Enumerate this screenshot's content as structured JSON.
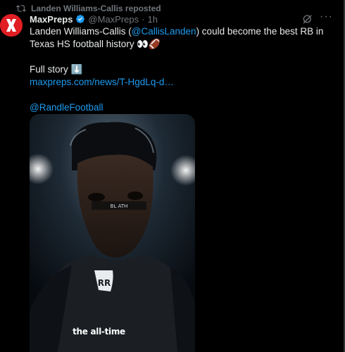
{
  "repost": {
    "text": "Landen Williams-Callis reposted",
    "icon": "repost-icon"
  },
  "post": {
    "author_name": "MaxPreps",
    "handle": "@MaxPreps",
    "separator": "·",
    "time": "1h",
    "avatar_icon": "maxpreps-logo-icon",
    "text_line1_a": "Landen Williams-Callis (",
    "text_mention": "@CallisLanden",
    "text_line1_b": ") could become the best RB in",
    "text_line2": "Texas HS football history 👀🏈",
    "full_story": "Full story ⬇️",
    "link": "maxpreps.com/news/T-HgdLq-d…",
    "tag": "@RandleFootball"
  },
  "media": {
    "caption": "the all-time",
    "helmet_logo": "RR",
    "eyeblack": "BL  ATH"
  },
  "colors": {
    "accent": "#1d9bf0",
    "muted": "#71767b",
    "brand": "#e01e24"
  }
}
